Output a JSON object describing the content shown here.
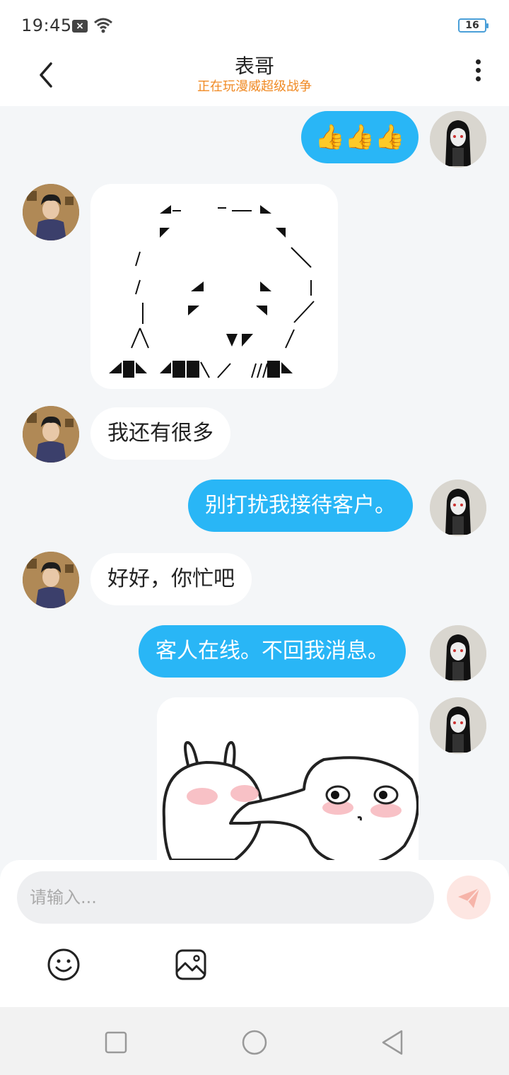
{
  "status_bar": {
    "time": "19:45",
    "battery": "16"
  },
  "header": {
    "title": "表哥",
    "subtitle": "正在玩漫威超级战争"
  },
  "messages": [
    {
      "from": "me",
      "type": "emoji",
      "text": "👍👍👍"
    },
    {
      "from": "them",
      "type": "ascii-art"
    },
    {
      "from": "them",
      "type": "text",
      "text": "我还有很多"
    },
    {
      "from": "me",
      "type": "text",
      "text": "别打扰我接待客户。"
    },
    {
      "from": "them",
      "type": "text",
      "text": "好好，你忙吧"
    },
    {
      "from": "me",
      "type": "text",
      "text": "客人在线。不回我消息。"
    },
    {
      "from": "me",
      "type": "sticker"
    }
  ],
  "input": {
    "placeholder": "请输入..."
  },
  "colors": {
    "accent": "#29b6f6",
    "subtitle": "#f08a24",
    "send_button": "#fde6e2"
  }
}
